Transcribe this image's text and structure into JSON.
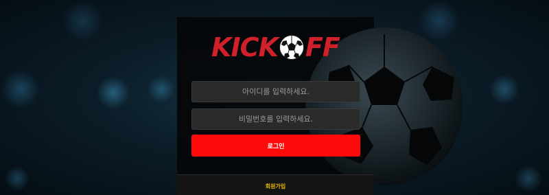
{
  "brand": {
    "logo_left": "KICK",
    "logo_right": "FF",
    "logo_color": "#d0202a"
  },
  "login_form": {
    "id_placeholder": "아이디를 입력하세요.",
    "password_placeholder": "비밀번호를 입력하세요.",
    "login_label": "로그인",
    "login_color": "#ff0a0a"
  },
  "footer": {
    "signup_label": "회원가입",
    "signup_color": "#e8b800"
  },
  "icons": {
    "background_ball": "soccer-ball-icon",
    "logo_ball": "soccer-ball-icon"
  }
}
